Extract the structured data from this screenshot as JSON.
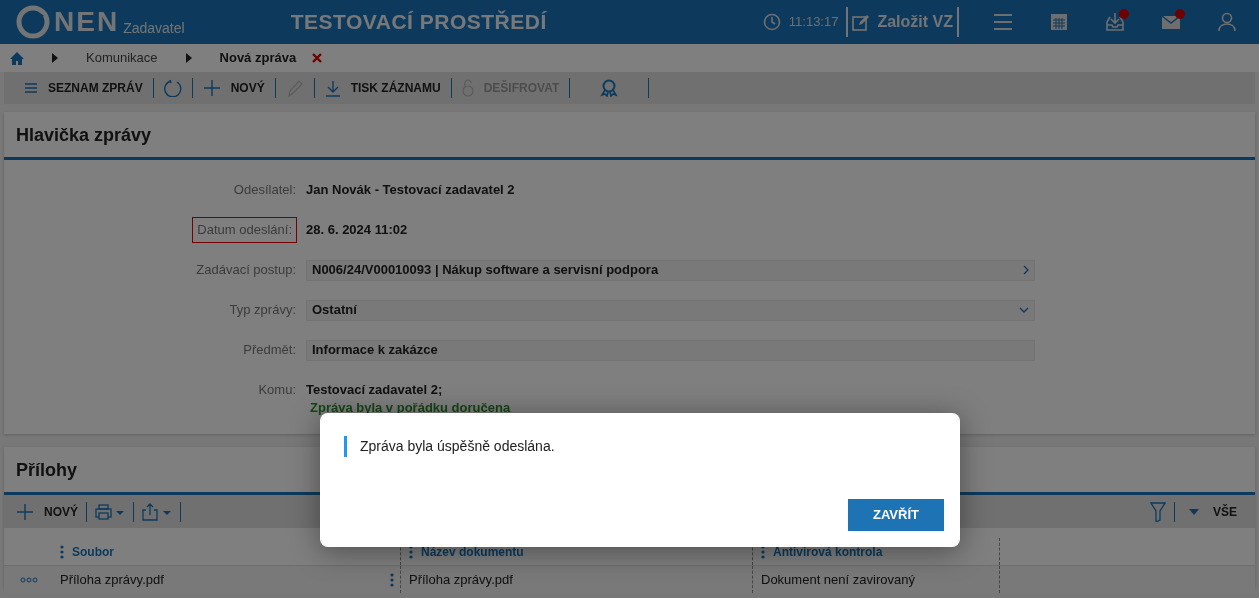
{
  "header": {
    "logo": "NEN",
    "subtitle": "Zadavatel",
    "environment": "TESTOVACÍ PROSTŘEDÍ",
    "time": "11:13:17",
    "create_button": "Založit VZ",
    "icons": [
      {
        "kind": "menu",
        "badge": false
      },
      {
        "kind": "calendar",
        "badge": false
      },
      {
        "kind": "inbox",
        "badge": true
      },
      {
        "kind": "mail",
        "badge": true
      },
      {
        "kind": "user",
        "badge": false
      }
    ]
  },
  "breadcrumb": {
    "items": [
      "Komunikace",
      "Nová zpráva"
    ]
  },
  "toolbar": [
    {
      "kind": "list",
      "label": "SEZNAM ZPRÁV",
      "disabled": false
    },
    {
      "kind": "refresh",
      "disabled": false
    },
    {
      "kind": "plus",
      "label": "NOVÝ",
      "disabled": false
    },
    {
      "kind": "pencil",
      "disabled": true
    },
    {
      "kind": "download",
      "label": "TISK ZÁZNAMU",
      "disabled": false
    },
    {
      "kind": "lock",
      "label": "DEŠIFROVAT",
      "disabled": true
    },
    {
      "kind": "award",
      "disabled": false
    }
  ],
  "header_section": {
    "title": "Hlavička zprávy",
    "fields": [
      {
        "label": "Odesílatel:",
        "value": "Jan Novák - Testovací zadavatel 2",
        "kind": "text",
        "highlighted": false
      },
      {
        "label": "Datum odeslání:",
        "value": "28. 6. 2024 11:02",
        "kind": "text",
        "highlighted": true
      },
      {
        "label": "Zadávací postup:",
        "value": "N006/24/V00010093 | Nákup software a servisní podpora",
        "kind": "link",
        "highlighted": false
      },
      {
        "label": "Typ zprávy:",
        "value": "Ostatní",
        "kind": "select",
        "highlighted": false
      },
      {
        "label": "Předmět:",
        "value": "Informace k zakázce",
        "kind": "input",
        "highlighted": false
      },
      {
        "label": "Komu:",
        "value": "Testovací zadavatel 2;",
        "kind": "text",
        "highlighted": false
      }
    ],
    "status": "Zpráva byla v pořádku doručena"
  },
  "attachments": {
    "title": "Přílohy",
    "new_label": "NOVÝ",
    "filter_label": "VŠE",
    "columns": [
      "Soubor",
      "Název dokumentu",
      "Antivirová kontrola"
    ],
    "rows": [
      [
        "Příloha zprávy.pdf",
        "Příloha zprávy.pdf",
        "Dokument není zavirovaný"
      ]
    ]
  },
  "dialog": {
    "message": "Zpráva byla úspěšně odeslána.",
    "button": "ZAVŘÍT"
  }
}
